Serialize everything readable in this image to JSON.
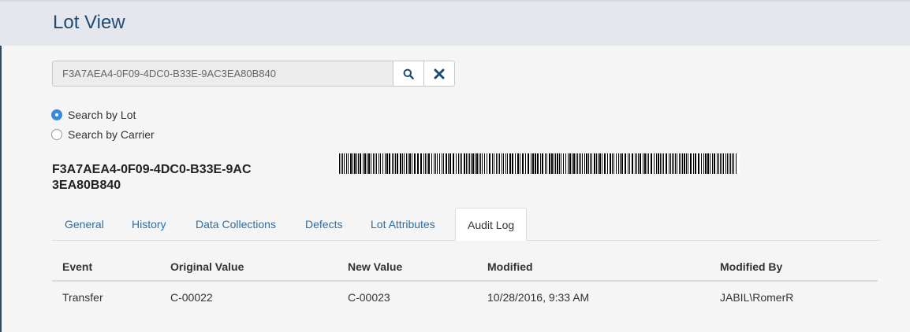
{
  "header": {
    "title": "Lot View"
  },
  "search": {
    "value": "F3A7AEA4-0F09-4DC0-B33E-9AC3EA80B840",
    "search_icon": "search-icon",
    "clear_icon": "close-icon"
  },
  "search_mode": {
    "options": [
      {
        "label": "Search by Lot",
        "checked": true
      },
      {
        "label": "Search by Carrier",
        "checked": false
      }
    ]
  },
  "lot": {
    "id": "F3A7AEA4-0F09-4DC0-B33E-9AC3EA80B840"
  },
  "tabs": [
    {
      "label": "General"
    },
    {
      "label": "History"
    },
    {
      "label": "Data Collections"
    },
    {
      "label": "Defects"
    },
    {
      "label": "Lot Attributes"
    },
    {
      "label": "Audit Log",
      "active": true
    }
  ],
  "audit_log": {
    "columns": [
      "Event",
      "Original Value",
      "New Value",
      "Modified",
      "Modified By"
    ],
    "rows": [
      [
        "Transfer",
        "C-00022",
        "C-00023",
        "10/28/2016, 9:33 AM",
        "JABIL\\RomerR"
      ]
    ]
  },
  "colors": {
    "accent": "#1f4b73",
    "link": "#2b6ea6",
    "radio_checked": "#3a8ad8"
  }
}
